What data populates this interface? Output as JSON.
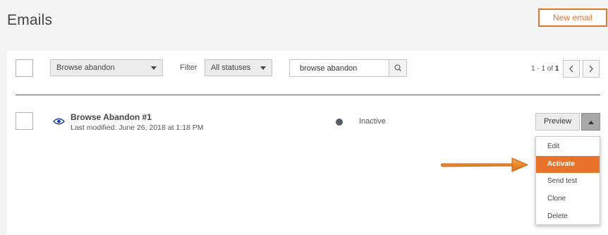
{
  "page": {
    "title": "Emails"
  },
  "header": {
    "new_email_label": "New email"
  },
  "toolbar": {
    "type_select": {
      "value": "Browse abandon"
    },
    "filter_label": "Filter",
    "status_select": {
      "value": "All statuses"
    },
    "search": {
      "value": "browse abandon"
    },
    "pagination": {
      "range": "1 - 1 of",
      "total": "1"
    }
  },
  "rows": [
    {
      "name": "Browse Abandon #1",
      "modified": "Last modified: June 26, 2018 at 1:18 PM",
      "status": "Inactive",
      "preview_label": "Preview"
    }
  ],
  "menu": {
    "items": [
      {
        "label": "Edit",
        "active": false
      },
      {
        "label": "Activate",
        "active": true
      },
      {
        "label": "Send test",
        "active": false
      },
      {
        "label": "Clone",
        "active": false
      },
      {
        "label": "Delete",
        "active": false
      }
    ]
  },
  "colors": {
    "accent": "#e8732a",
    "eye_icon": "#1f3f9f",
    "status_inactive": "#555d68"
  },
  "icons": [
    "search-icon",
    "chevron-left-icon",
    "chevron-right-icon",
    "eye-icon",
    "caret-up-icon",
    "arrow-annotation"
  ]
}
